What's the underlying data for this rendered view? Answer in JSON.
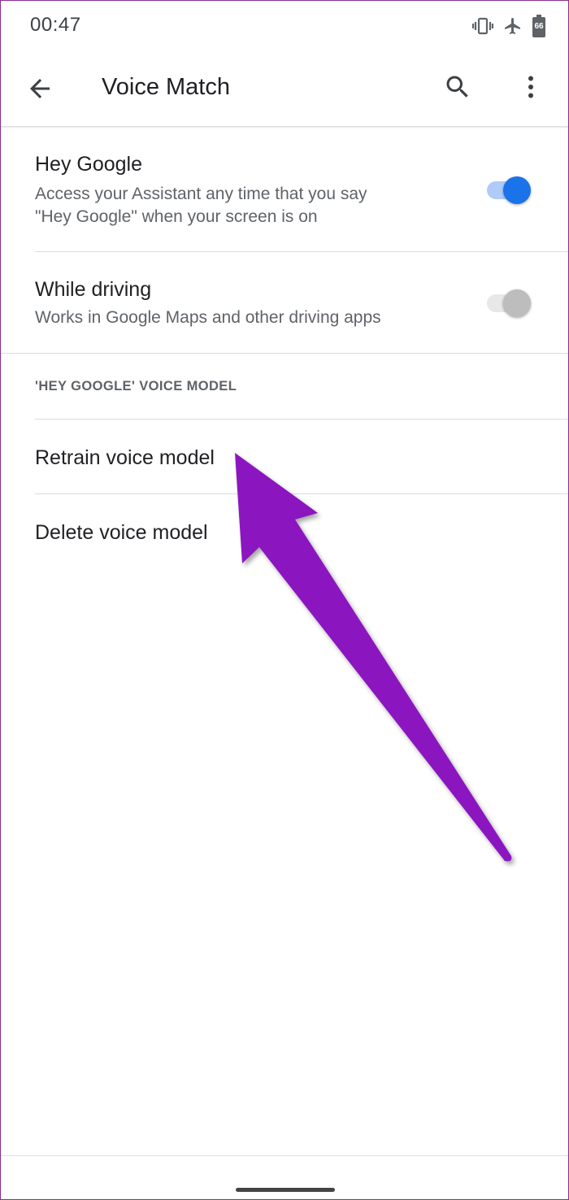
{
  "status_bar": {
    "time": "00:47",
    "icons": [
      "vibrate-icon",
      "airplane-mode-icon",
      "battery-icon"
    ],
    "battery_level": "66"
  },
  "app_bar": {
    "title": "Voice Match",
    "icons": [
      "back-arrow-icon",
      "search-icon",
      "more-vert-icon"
    ]
  },
  "settings": [
    {
      "title": "Hey Google",
      "subtitle_line1": "Access your Assistant any time that you say",
      "subtitle_line2": "\"Hey Google\" when your screen is on",
      "toggle_on": true
    },
    {
      "title": "While driving",
      "subtitle_line1": "Works in Google Maps and other driving apps",
      "toggle_on": false
    }
  ],
  "voice_model_section": {
    "header": "'HEY GOOGLE' VOICE MODEL",
    "items": [
      {
        "label": "Retrain voice model"
      },
      {
        "label": "Delete voice model"
      }
    ]
  },
  "colors": {
    "accent": "#1a73e8",
    "accent_track": "#aecbfa",
    "toggle_off_thumb": "#bdbdbd",
    "toggle_off_track": "#e8e8e8",
    "annotation_arrow": "#8b12c0",
    "frame_border": "#8a2c8f"
  },
  "annotation": {
    "icon": "pointer-arrow-icon"
  }
}
